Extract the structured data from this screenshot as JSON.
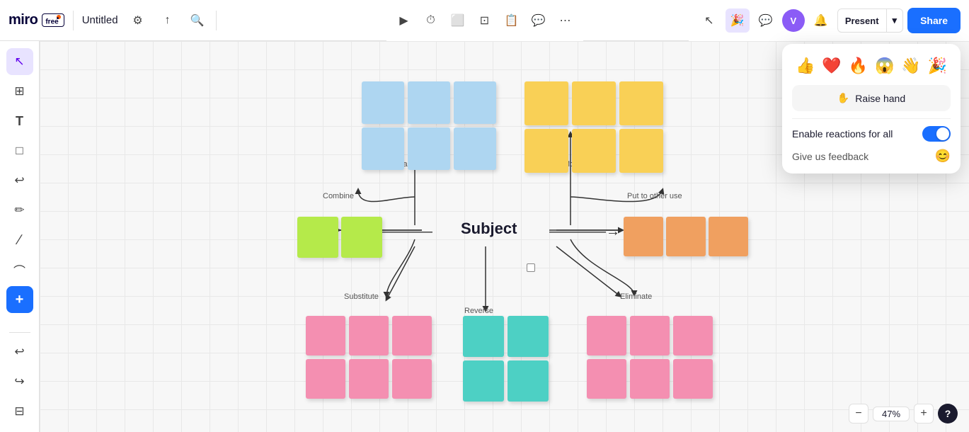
{
  "topbar": {
    "logo": "miro",
    "free_label": "free",
    "title": "Untitled",
    "settings_icon": "⚙",
    "share_icon": "↑",
    "search_icon": "🔍"
  },
  "center_toolbar": {
    "tools": [
      "▶",
      "⏱",
      "⬜",
      "⊡",
      "📋",
      "💬",
      "⋯"
    ]
  },
  "right_toolbar": {
    "cursor_icon": "cursor",
    "reactions_icon": "🎉",
    "comments_icon": "💬",
    "avatar_initials": "V",
    "notif_icon": "🔔",
    "present_label": "Present",
    "share_label": "Share"
  },
  "sidebar": {
    "tools": [
      "↖",
      "⊞",
      "T",
      "□",
      "↩",
      "✏",
      "∕",
      "⌒",
      "+",
      "↩",
      "↪",
      "⊟"
    ]
  },
  "canvas": {
    "subject_label": "Subject",
    "adapt_label": "Adapt",
    "modify_label": "Modify",
    "combine_label": "Combine",
    "put_other_use_label": "Put to other use",
    "substitute_label": "Substitute",
    "reverse_label": "Reverse",
    "eliminate_label": "Eliminate"
  },
  "reactions_popup": {
    "emojis": [
      "👍",
      "❤️",
      "🔥",
      "😱",
      "👋",
      "🎉"
    ],
    "raise_hand_label": "Raise hand",
    "raise_hand_icon": "✋",
    "enable_reactions_label": "Enable reactions for all",
    "feedback_label": "Give us feedback",
    "feedback_icon": "😊"
  },
  "zoom": {
    "level": "47%",
    "minus_icon": "−",
    "plus_icon": "+",
    "help_icon": "?"
  }
}
